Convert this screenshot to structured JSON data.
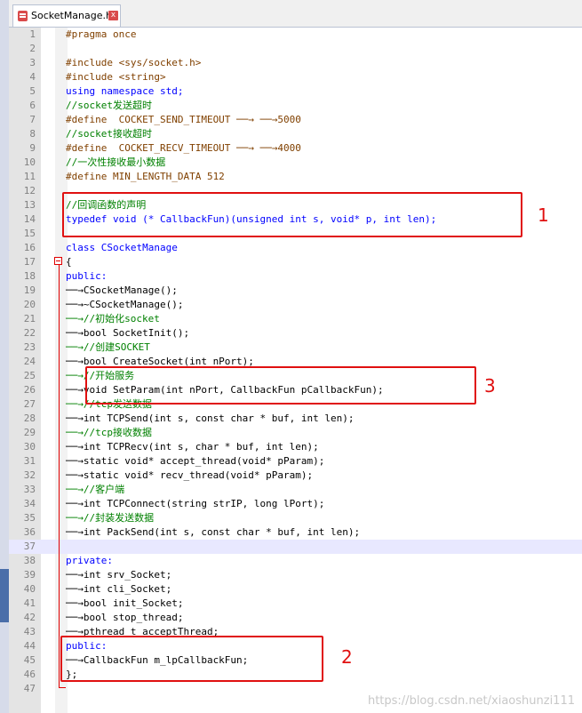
{
  "tab": {
    "filename": "SocketManage.h",
    "close_symbol": "x"
  },
  "lines": [
    "#pragma once",
    "",
    "#include <sys/socket.h>",
    "#include <string>",
    "using namespace std;",
    "//socket发送超时",
    "#define  COCKET_SEND_TIMEOUT ──→ ──→5000",
    "//socket接收超时",
    "#define  COCKET_RECV_TIMEOUT ──→ ──→4000",
    "//一次性接收最小数据",
    "#define MIN_LENGTH_DATA 512",
    "",
    "//回调函数的声明",
    "typedef void (* CallbackFun)(unsigned int s, void* p, int len);",
    "",
    "class CSocketManage",
    "{",
    "public:",
    "──→CSocketManage();",
    "──→~CSocketManage();",
    "──→//初始化socket",
    "──→bool SocketInit();",
    "──→//创建SOCKET",
    "──→bool CreateSocket(int nPort);",
    "──→//开始服务",
    "──→void SetParam(int nPort, CallbackFun pCallbackFun);",
    "──→//tcp发送数据",
    "──→int TCPSend(int s, const char * buf, int len);",
    "──→//tcp接收数据",
    "──→int TCPRecv(int s, char * buf, int len);",
    "──→static void* accept_thread(void* pParam);",
    "──→static void* recv_thread(void* pParam);",
    "──→//客户端",
    "──→int TCPConnect(string strIP, long lPort);",
    "──→//封装发送数据",
    "──→int PackSend(int s, const char * buf, int len);",
    "",
    "private:",
    "──→int srv_Socket;",
    "──→int cli_Socket;",
    "──→bool init_Socket;",
    "──→bool stop_thread;",
    "──→pthread_t acceptThread;",
    "public:",
    "──→CallbackFun m_lpCallbackFun;",
    "};",
    ""
  ],
  "line_numbers": [
    "1",
    "2",
    "3",
    "4",
    "5",
    "6",
    "7",
    "8",
    "9",
    "10",
    "11",
    "12",
    "13",
    "14",
    "15",
    "16",
    "17",
    "18",
    "19",
    "20",
    "21",
    "22",
    "23",
    "24",
    "25",
    "26",
    "27",
    "28",
    "29",
    "30",
    "31",
    "32",
    "33",
    "34",
    "35",
    "36",
    "37",
    "38",
    "39",
    "40",
    "41",
    "42",
    "43",
    "44",
    "45",
    "46",
    "47"
  ],
  "current_line": 37,
  "annotations": [
    {
      "label": "1"
    },
    {
      "label": "2"
    },
    {
      "label": "3"
    }
  ],
  "watermark": "https://blog.csdn.net/xiaoshunzi111",
  "colors": {
    "comment": "#008000",
    "keyword": "#0000ff",
    "preprocessor": "#804000",
    "type": "#8000ff",
    "number": "#ff8000",
    "highlight_box": "#e01010"
  }
}
